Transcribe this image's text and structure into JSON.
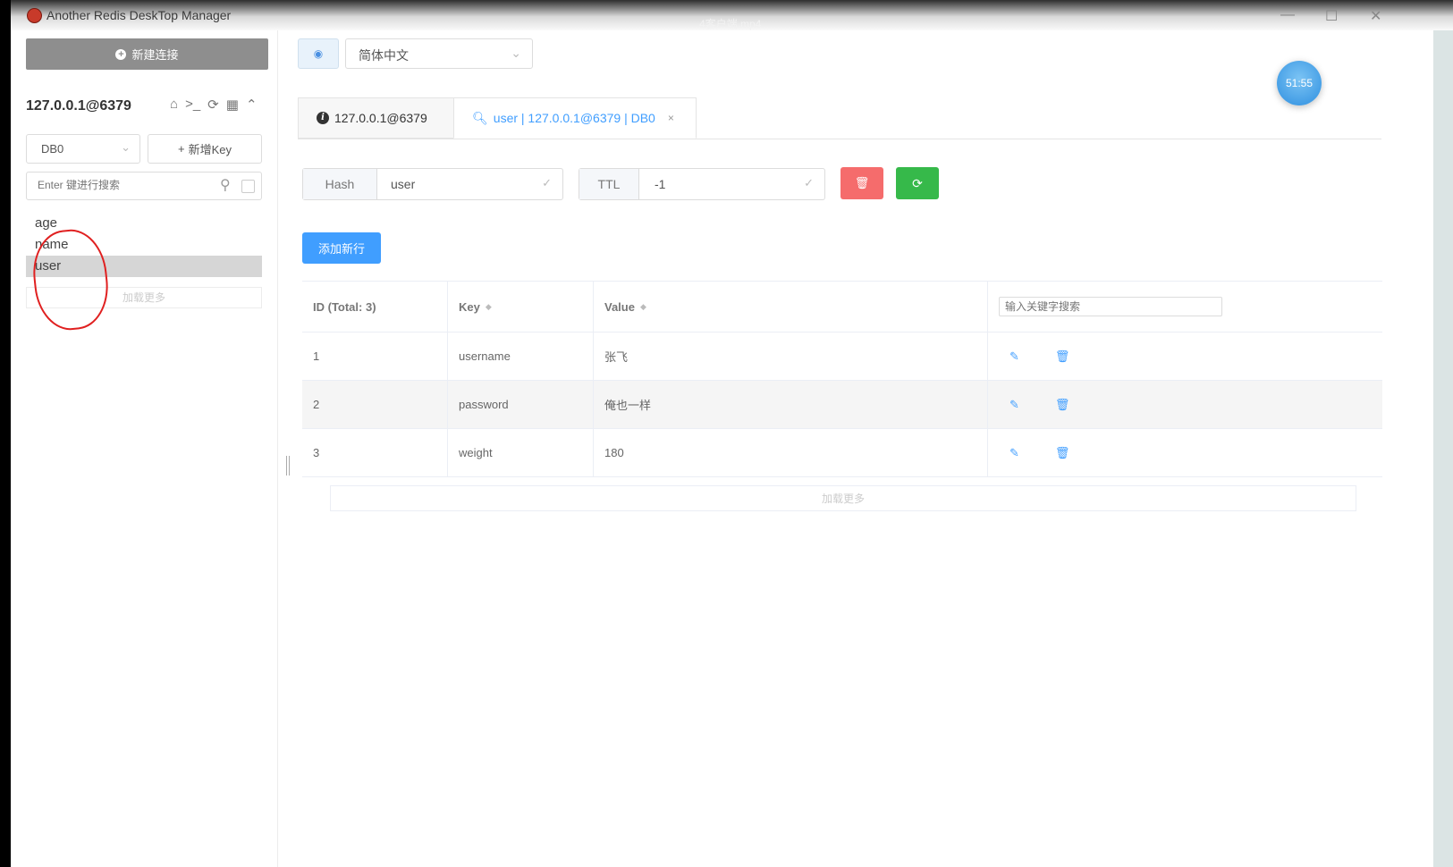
{
  "titlebar": {
    "app_title": "Another Redis DeskTop Manager",
    "video_title": "4客户端.mp4",
    "minimize": "—",
    "maximize": "☐",
    "close": "✕"
  },
  "sidebar": {
    "new_connection_label": "新建连接",
    "connection_name": "127.0.0.1@6379",
    "db_select_value": "DB0",
    "new_key_label": "新增Key",
    "search_placeholder": "Enter 键进行搜索",
    "keys": [
      {
        "name": "age"
      },
      {
        "name": "name"
      },
      {
        "name": "user"
      }
    ],
    "load_more_label": "加载更多"
  },
  "toolbar": {
    "language_value": "简体中文"
  },
  "clock_badge": "51:55",
  "tabs": [
    {
      "label": "127.0.0.1@6379"
    },
    {
      "label": "user | 127.0.0.1@6379 | DB0"
    }
  ],
  "key_detail": {
    "type_label": "Hash",
    "key_name": "user",
    "ttl_label": "TTL",
    "ttl_value": "-1",
    "add_row_label": "添加新行"
  },
  "table": {
    "headers": {
      "id": "ID (Total: 3)",
      "key": "Key",
      "value": "Value"
    },
    "search_placeholder": "输入关键字搜索",
    "rows": [
      {
        "id": "1",
        "key": "username",
        "value": "张飞"
      },
      {
        "id": "2",
        "key": "password",
        "value": "俺也一样"
      },
      {
        "id": "3",
        "key": "weight",
        "value": "180"
      }
    ],
    "load_more_label": "加载更多"
  },
  "colors": {
    "accent": "#409eff",
    "danger": "#f56c6c",
    "success": "#36b94a",
    "annotation_red": "#e02020"
  }
}
